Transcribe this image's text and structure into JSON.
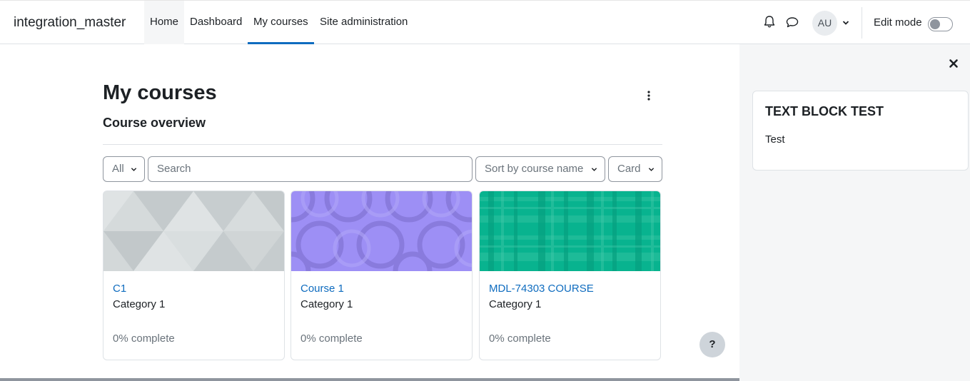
{
  "navbar": {
    "brand": "integration_master",
    "links": [
      "Home",
      "Dashboard",
      "My courses",
      "Site administration"
    ],
    "user_initials": "AU",
    "edit_mode_label": "Edit mode"
  },
  "main": {
    "page_title": "My courses",
    "section_title": "Course overview",
    "filters": {
      "grouping": "All",
      "search_placeholder": "Search",
      "sort": "Sort by course name",
      "view": "Card"
    },
    "courses": [
      {
        "name": "C1",
        "category": "Category 1",
        "progress": "0% complete"
      },
      {
        "name": "Course 1",
        "category": "Category 1",
        "progress": "0% complete"
      },
      {
        "name": "MDL-74303 COURSE",
        "category": "Category 1",
        "progress": "0% complete"
      }
    ],
    "help_label": "?"
  },
  "drawer": {
    "block_title": "TEXT BLOCK TEST",
    "block_body": "Test"
  },
  "colors": {
    "accent": "#0f6cbf",
    "card_1_bg": "#ced4d6",
    "card_2_bg": "#9d8ff5",
    "card_3_bg": "#08b38f"
  }
}
